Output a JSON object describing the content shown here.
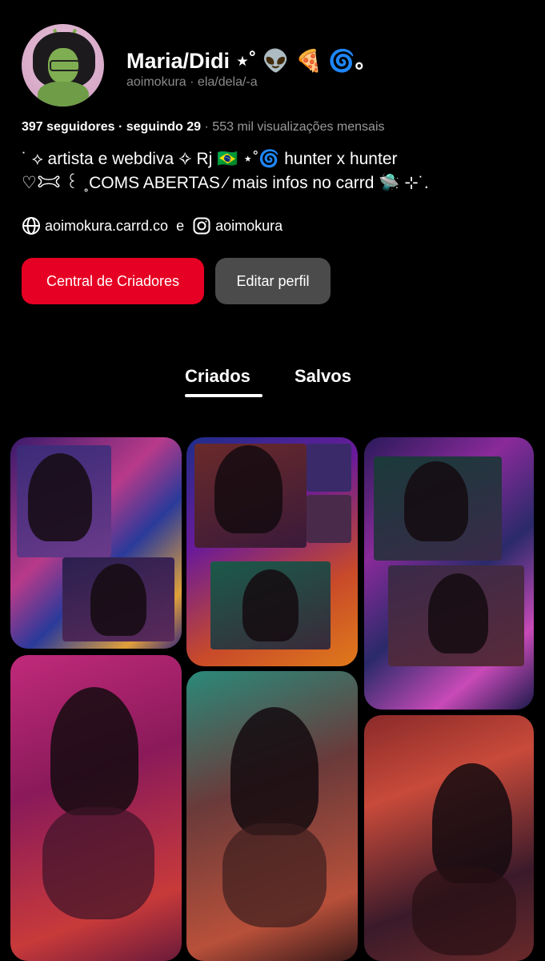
{
  "profile": {
    "name": "Maria/Didi ⋆˚ 👽 🍕 🌀｡",
    "username": "aoimokura",
    "pronouns": "ela/dela/-a",
    "handle_separator": " · "
  },
  "stats": {
    "followers": "397 seguidores",
    "following": "seguindo 29",
    "views": "553 mil visualizações mensais",
    "sep": " · "
  },
  "bio": {
    "line1": "˙ ⟡ artista e webdiva ✧ Rj 🇧🇷 ⋆˚🌀 hunter x hunter",
    "line2": "♡𐂯 ꒰ ˳COMS ABERTAS ⁄ mais infos no carrd 🛸 ⊹˙."
  },
  "links": {
    "website": "aoimokura.carrd.co",
    "connector": "e",
    "instagram": "aoimokura",
    "website_icon": "globe-icon",
    "instagram_icon": "instagram-icon"
  },
  "buttons": {
    "creator_hub": "Central de Criadores",
    "edit_profile": "Editar perfil"
  },
  "tabs": {
    "created": "Criados",
    "saved": "Salvos",
    "active": "created"
  },
  "colors": {
    "accent_red": "#e60023",
    "button_gray": "#4b4b4b",
    "muted_text": "#8a8a8a",
    "background": "#000000"
  }
}
